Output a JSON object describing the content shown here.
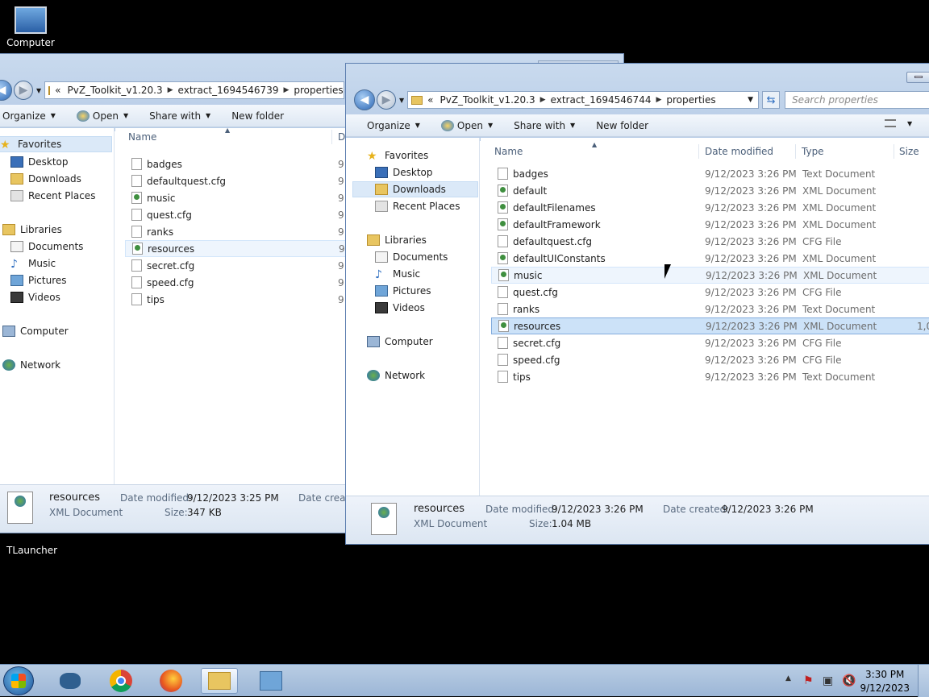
{
  "desktop": {
    "icons": [
      {
        "label": "Computer"
      },
      {
        "label": "TLauncher"
      }
    ]
  },
  "back_window": {
    "breadcrumb": [
      "PvZ_Toolkit_v1.20.3",
      "extract_1694546739",
      "properties"
    ],
    "toolbar": {
      "organize": "Organize",
      "open": "Open",
      "share": "Share with",
      "new_folder": "New folder"
    },
    "nav": {
      "favorites": "Favorites",
      "desktop": "Desktop",
      "downloads": "Downloads",
      "recent": "Recent Places",
      "libraries": "Libraries",
      "documents": "Documents",
      "music": "Music",
      "pictures": "Pictures",
      "videos": "Videos",
      "computer": "Computer",
      "network": "Network"
    },
    "columns": {
      "name": "Name",
      "date": "D"
    },
    "files": [
      {
        "name": "badges",
        "type": "txt",
        "date": "9"
      },
      {
        "name": "defaultquest.cfg",
        "type": "cfg",
        "date": "9"
      },
      {
        "name": "music",
        "type": "xml",
        "date": "9"
      },
      {
        "name": "quest.cfg",
        "type": "cfg",
        "date": "9"
      },
      {
        "name": "ranks",
        "type": "txt",
        "date": "9"
      },
      {
        "name": "resources",
        "type": "xml",
        "date": "9"
      },
      {
        "name": "secret.cfg",
        "type": "cfg",
        "date": "9"
      },
      {
        "name": "speed.cfg",
        "type": "cfg",
        "date": "9"
      },
      {
        "name": "tips",
        "type": "txt",
        "date": "9"
      }
    ],
    "details": {
      "name": "resources",
      "type": "XML Document",
      "date_label": "Date modified:",
      "date": "9/12/2023 3:25 PM",
      "size_label": "Size:",
      "size": "347 KB",
      "created_label": "Date create"
    }
  },
  "front_window": {
    "breadcrumb": [
      "PvZ_Toolkit_v1.20.3",
      "extract_1694546744",
      "properties"
    ],
    "search_placeholder": "Search properties",
    "toolbar": {
      "organize": "Organize",
      "open": "Open",
      "share": "Share with",
      "new_folder": "New folder"
    },
    "nav": {
      "favorites": "Favorites",
      "desktop": "Desktop",
      "downloads": "Downloads",
      "recent": "Recent Places",
      "libraries": "Libraries",
      "documents": "Documents",
      "music": "Music",
      "pictures": "Pictures",
      "videos": "Videos",
      "computer": "Computer",
      "network": "Network"
    },
    "columns": {
      "name": "Name",
      "date": "Date modified",
      "type": "Type",
      "size": "Size"
    },
    "files": [
      {
        "name": "badges",
        "date": "9/12/2023 3:26 PM",
        "type": "Text Document",
        "kind": "txt"
      },
      {
        "name": "default",
        "date": "9/12/2023 3:26 PM",
        "type": "XML Document",
        "kind": "xml"
      },
      {
        "name": "defaultFilenames",
        "date": "9/12/2023 3:26 PM",
        "type": "XML Document",
        "kind": "xml"
      },
      {
        "name": "defaultFramework",
        "date": "9/12/2023 3:26 PM",
        "type": "XML Document",
        "kind": "xml"
      },
      {
        "name": "defaultquest.cfg",
        "date": "9/12/2023 3:26 PM",
        "type": "CFG File",
        "kind": "cfg"
      },
      {
        "name": "defaultUIConstants",
        "date": "9/12/2023 3:26 PM",
        "type": "XML Document",
        "kind": "xml"
      },
      {
        "name": "music",
        "date": "9/12/2023 3:26 PM",
        "type": "XML Document",
        "kind": "xml"
      },
      {
        "name": "quest.cfg",
        "date": "9/12/2023 3:26 PM",
        "type": "CFG File",
        "kind": "cfg"
      },
      {
        "name": "ranks",
        "date": "9/12/2023 3:26 PM",
        "type": "Text Document",
        "kind": "txt"
      },
      {
        "name": "resources",
        "date": "9/12/2023 3:26 PM",
        "type": "XML Document",
        "kind": "xml",
        "size": "1,0("
      },
      {
        "name": "secret.cfg",
        "date": "9/12/2023 3:26 PM",
        "type": "CFG File",
        "kind": "cfg"
      },
      {
        "name": "speed.cfg",
        "date": "9/12/2023 3:26 PM",
        "type": "CFG File",
        "kind": "cfg"
      },
      {
        "name": "tips",
        "date": "9/12/2023 3:26 PM",
        "type": "Text Document",
        "kind": "txt"
      }
    ],
    "details": {
      "name": "resources",
      "type": "XML Document",
      "date_label": "Date modified:",
      "date": "9/12/2023 3:26 PM",
      "size_label": "Size:",
      "size": "1.04 MB",
      "created_label": "Date created:",
      "created": "9/12/2023 3:26 PM"
    }
  },
  "taskbar": {
    "time": "3:30 PM",
    "date": "9/12/2023"
  }
}
